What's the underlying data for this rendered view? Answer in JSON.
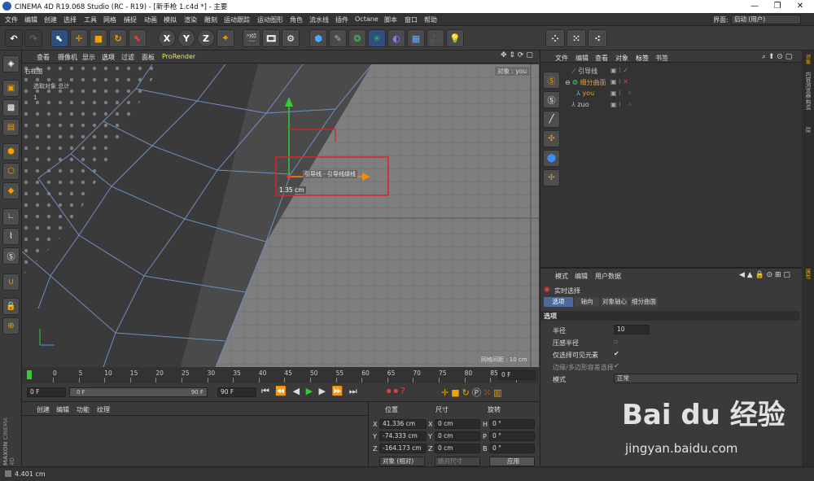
{
  "window": {
    "title": "CINEMA 4D R19.068 Studio (RC - R19) - [新手枪 1.c4d *] - 主要",
    "minimize": "—",
    "maximize": "❐",
    "close": "✕"
  },
  "menubar": {
    "items": [
      "文件",
      "编辑",
      "创建",
      "选择",
      "工具",
      "网格",
      "捕捉",
      "动画",
      "模拟",
      "渲染",
      "雕刻",
      "运动跟踪",
      "运动图形",
      "角色",
      "流水线",
      "插件",
      "Octane",
      "脚本",
      "窗口",
      "帮助"
    ],
    "layout_label": "界面:",
    "layout_value": "启动 (用户)"
  },
  "toolbar": {
    "axis_x": "X",
    "axis_y": "Y",
    "axis_z": "Z"
  },
  "viewport": {
    "menu": [
      "查看",
      "摄像机",
      "显示",
      "选项",
      "过滤",
      "面板",
      "ProRender"
    ],
    "view_name": "右视图",
    "hud_selected_label": "选取对象 总计",
    "hud_count": "1",
    "object_label": "对象",
    "object_name": "you",
    "tooltip_label": "引导线 - 引导线绿线",
    "measure": "1.35 cm",
    "grid_spacing": "网格间距 : 10 cm"
  },
  "timeline": {
    "ticks": [
      "0",
      "5",
      "10",
      "15",
      "20",
      "25",
      "30",
      "35",
      "40",
      "45",
      "50",
      "55",
      "60",
      "65",
      "70",
      "75",
      "80",
      "85",
      "90"
    ],
    "current_frame": "0 F"
  },
  "transport": {
    "start": "0 F",
    "range_start": "0 F",
    "range_end": "90 F",
    "end": "90 F"
  },
  "material_panel": {
    "menu": [
      "创建",
      "编辑",
      "功能",
      "纹理"
    ]
  },
  "coordinates": {
    "headers": [
      "位置",
      "尺寸",
      "旋转"
    ],
    "rows": [
      {
        "axis": "X",
        "pos": "41.336 cm",
        "size_axis": "X",
        "size": "0 cm",
        "rot_axis": "H",
        "rot": "0 °"
      },
      {
        "axis": "Y",
        "pos": "-74.333 cm",
        "size_axis": "Y",
        "size": "0 cm",
        "rot_axis": "P",
        "rot": "0 °"
      },
      {
        "axis": "Z",
        "pos": "-164.173 cm",
        "size_axis": "Z",
        "size": "0 cm",
        "rot_axis": "B",
        "rot": "0 °"
      }
    ],
    "mode": "对象 (相对)",
    "size_mode": "绝对尺寸",
    "apply": "应用"
  },
  "object_manager": {
    "menu": [
      "文件",
      "编辑",
      "查看",
      "对象",
      "标签",
      "书签"
    ],
    "objects": [
      {
        "name": "引导线",
        "indent": 0,
        "color": "#cccccc"
      },
      {
        "name": "细分曲面",
        "indent": 0,
        "color": "#e0a030"
      },
      {
        "name": "you",
        "indent": 1,
        "color": "#e0a030"
      },
      {
        "name": "zuo",
        "indent": 0,
        "color": "#cccccc"
      }
    ]
  },
  "attributes": {
    "menu": [
      "模式",
      "编辑",
      "用户数据"
    ],
    "tool_name": "实时选择",
    "tabs": [
      "选项",
      "轴向",
      "对象轴心",
      "细分曲面"
    ],
    "section": "选项",
    "radius_label": "半径",
    "radius_value": "10",
    "pressure_label": "压感半径",
    "visible_only_label": "仅选择可见元素",
    "edge_label": "边缘/多边形容差选择",
    "mode_label": "模式",
    "mode_value": "正常"
  },
  "right_tabs": [
    "对象",
    "内容浏览器",
    "构造",
    "层"
  ],
  "right_tabs_bottom": [
    "属性"
  ],
  "status": {
    "text": "4.401 cm"
  },
  "brand": {
    "maxon": "MAXON",
    "cinema": "CINEMA 4D"
  },
  "watermark": {
    "text": "Bai du 经验",
    "url": "jingyan.baidu.com"
  },
  "colors": {
    "accent": "#4d6a9a",
    "selection_box": "#e0222a",
    "yaxis": "#33cc33",
    "xaxis": "#ff8800"
  }
}
